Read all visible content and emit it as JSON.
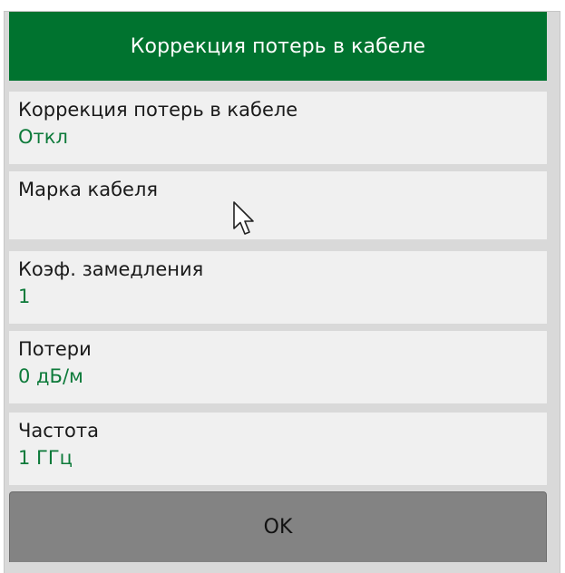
{
  "dialog": {
    "title": "Коррекция потерь в кабеле",
    "items": [
      {
        "label": "Коррекция потерь в кабеле",
        "value": "Откл"
      },
      {
        "label": "Марка кабеля",
        "value": ""
      },
      {
        "label": "Коэф. замедления",
        "value": "1"
      },
      {
        "label": "Потери",
        "value": "0 дБ/м"
      },
      {
        "label": "Частота",
        "value": "1 ГГц"
      }
    ],
    "ok_label": "OK"
  },
  "colors": {
    "header_bg": "#00732f",
    "value_text": "#0d7a3a",
    "item_bg": "#f0f0f0",
    "panel_bg": "#d9d9d9",
    "ok_bg": "#838383"
  },
  "icons": {
    "cursor": "mouse-pointer-icon"
  }
}
